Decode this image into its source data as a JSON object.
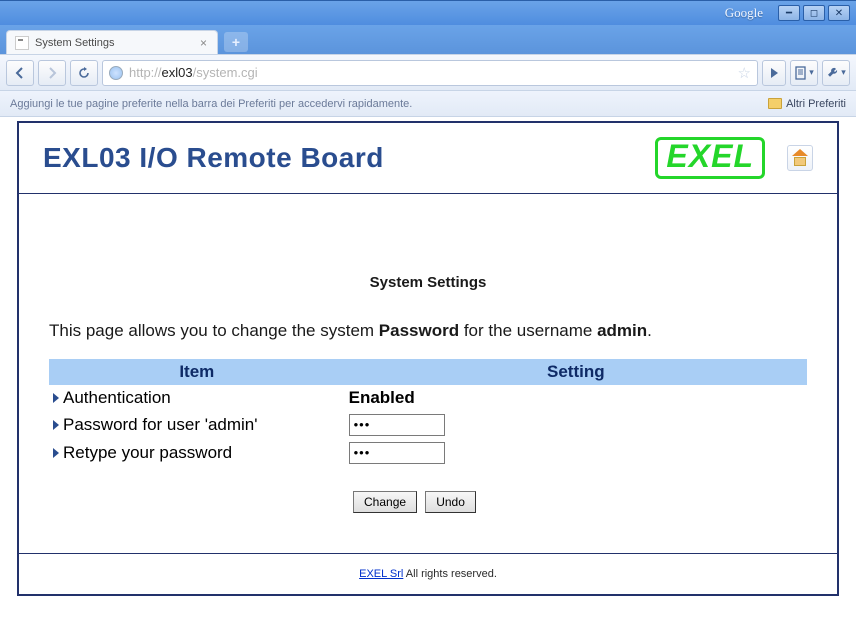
{
  "browser": {
    "google_label": "Google",
    "tab_title": "System Settings",
    "url_scheme": "http://",
    "url_host": "exl03",
    "url_path": "/system.cgi",
    "bookmarks_hint": "Aggiungi le tue pagine preferite nella barra dei Preferiti per accedervi rapidamente.",
    "other_bookmarks": "Altri Preferiti"
  },
  "page": {
    "board_title": "EXL03 I/O Remote Board",
    "logo_text": "EXEL",
    "heading": "System Settings",
    "intro_prefix": "This page allows you to change the system ",
    "intro_bold1": "Password",
    "intro_mid": " for the username ",
    "intro_bold2": "admin",
    "intro_suffix": ".",
    "col_item": "Item",
    "col_setting": "Setting",
    "rows": {
      "r0": {
        "label": "Authentication",
        "value": "Enabled"
      },
      "r1": {
        "label": "Password for user 'admin'",
        "value": "•••"
      },
      "r2": {
        "label": "Retype your password",
        "value": "•••"
      }
    },
    "btn_change": "Change",
    "btn_undo": "Undo",
    "footer_link": "EXEL Srl",
    "footer_rest": " All rights reserved."
  }
}
